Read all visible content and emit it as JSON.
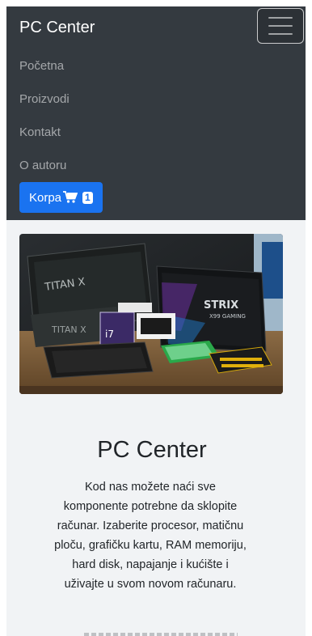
{
  "navbar": {
    "brand": "PC Center",
    "toggler_icon": "hamburger-icon",
    "items": [
      {
        "label": "Početna"
      },
      {
        "label": "Proizvodi"
      },
      {
        "label": "Kontakt"
      },
      {
        "label": "O autoru"
      }
    ],
    "cart": {
      "label": "Korpa",
      "icon": "cart-icon",
      "count": "1"
    }
  },
  "hero": {
    "title": "PC Center",
    "description": "Kod nas možete naći sve komponente potrebne da sklopite računar. Izaberite procesor, matičnu ploču, grafičku kartu, RAM memoriju, hard disk, napajanje i kućište i uživajte u svom novom računaru."
  },
  "colors": {
    "navbar_bg": "#343a40",
    "primary": "#1a73f0",
    "content_bg": "#f1f3f5"
  }
}
